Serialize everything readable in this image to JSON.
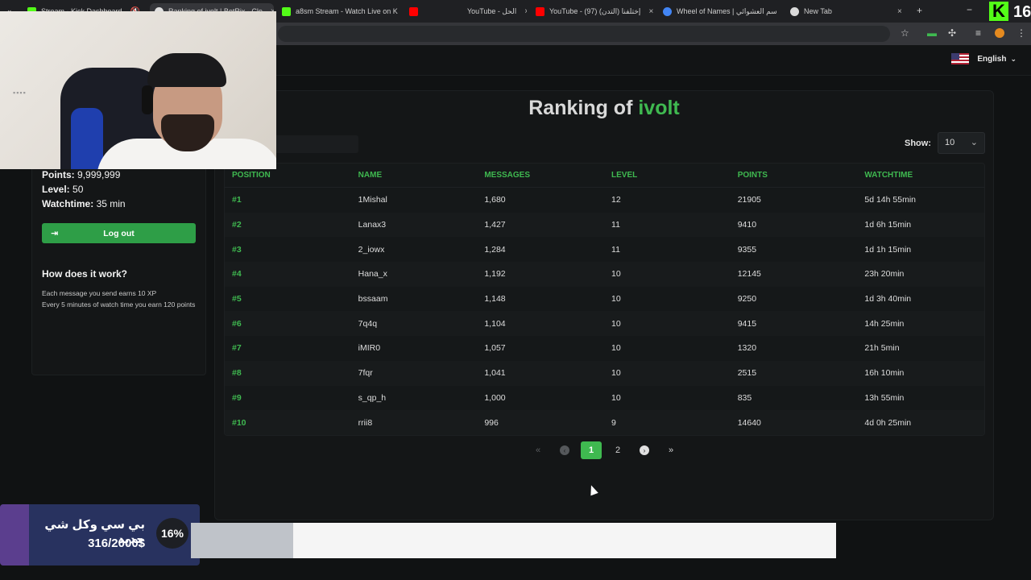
{
  "browser": {
    "tabs": [
      {
        "title": "Stream - Kick Dashboard",
        "fav": "#53fc18"
      },
      {
        "title": "Ranking of ivolt | BotRix - Clo",
        "fav": "#e0e0e0"
      },
      {
        "title": "a8sm Stream - Watch Live on K",
        "fav": "#53fc18"
      },
      {
        "title": "",
        "fav": "#ff0000"
      },
      {
        "title": "YouTube - الحل",
        "fav": "#ff0000"
      },
      {
        "title": "YouTube - (97) إختلفنا (التدن)",
        "fav": "#ff0000"
      },
      {
        "title": "Wheel of Names | سم العشوائي",
        "fav": "#4285f4"
      },
      {
        "title": "New Tab",
        "fav": "#dadada"
      }
    ],
    "new_tab_symbol": "+",
    "close_symbol": "×"
  },
  "header": {
    "language": "English"
  },
  "ranking": {
    "title_prefix": "Ranking of",
    "title_name": "ivolt",
    "show_label": "Show:",
    "show_value": "10",
    "columns": [
      "POSITION",
      "NAME",
      "MESSAGES",
      "LEVEL",
      "POINTS",
      "WATCHTIME"
    ],
    "rows": [
      [
        "#1",
        "1Mishal",
        "1,680",
        "12",
        "21905",
        "5d 14h 55min"
      ],
      [
        "#2",
        "Lanax3",
        "1,427",
        "11",
        "9410",
        "1d 6h 15min"
      ],
      [
        "#3",
        "2_iowx",
        "1,284",
        "11",
        "9355",
        "1d 1h 15min"
      ],
      [
        "#4",
        "Hana_x",
        "1,192",
        "10",
        "12145",
        "23h 20min"
      ],
      [
        "#5",
        "bssaam",
        "1,148",
        "10",
        "9250",
        "1d 3h 40min"
      ],
      [
        "#6",
        "7q4q",
        "1,104",
        "10",
        "9415",
        "14h 25min"
      ],
      [
        "#7",
        "iMIR0",
        "1,057",
        "10",
        "1320",
        "21h 5min"
      ],
      [
        "#8",
        "7fqr",
        "1,041",
        "10",
        "2515",
        "16h 10min"
      ],
      [
        "#9",
        "s_qp_h",
        "1,000",
        "10",
        "835",
        "13h 55min"
      ],
      [
        "#10",
        "rrii8",
        "996",
        "9",
        "14640",
        "4d 0h 25min"
      ]
    ],
    "pagination": {
      "first": "«",
      "prev": "‹",
      "pages": [
        "1",
        "2"
      ],
      "active": "1",
      "next": "›",
      "last": "»"
    }
  },
  "sidebar": {
    "points_label": "Points:",
    "points_value": "9,999,999",
    "level_label": "Level:",
    "level_value": "50",
    "watch_label": "Watchtime:",
    "watch_value": "35 min",
    "logout_label": "Log out",
    "how_title": "How does it work?",
    "how_line1": "Each message you send earns 10 XP",
    "how_line2": "Every 5 minutes of watch time you earn 120 points"
  },
  "overlay": {
    "goal_title": "بي سي وكل شي جديد",
    "goal_amount": "316/2000$",
    "goal_percent": "16%",
    "goal_progress": 0.158,
    "kick_logo": "K",
    "kick_count": "16"
  }
}
